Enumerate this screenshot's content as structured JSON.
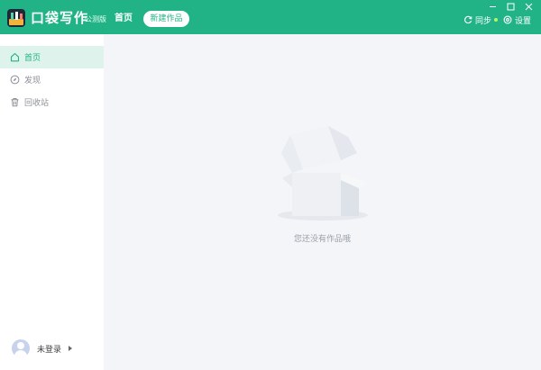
{
  "app": {
    "name": "口袋写作",
    "badge": "公测版"
  },
  "header": {
    "nav_home": "首页",
    "new_work_button": "新建作品",
    "sync_label": "同步",
    "settings_label": "设置"
  },
  "sidebar": {
    "items": [
      {
        "label": "首页",
        "icon": "home-icon",
        "active": true
      },
      {
        "label": "发现",
        "icon": "compass-icon",
        "active": false
      },
      {
        "label": "回收站",
        "icon": "trash-icon",
        "active": false
      }
    ],
    "user_label": "未登录"
  },
  "main": {
    "empty_text": "您还没有作品哦"
  },
  "colors": {
    "accent": "#21b385",
    "active_bg": "#ddf3eb",
    "content_bg": "#f4f5f9",
    "sync_dot": "#b6f56a"
  }
}
